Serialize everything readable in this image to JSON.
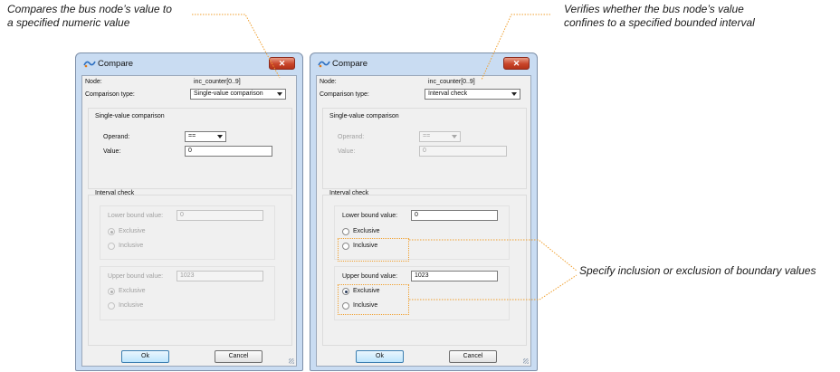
{
  "annotations": {
    "left_line1": "Compares the bus node’s value to",
    "left_line2": "a specified numeric value",
    "right_line1": "Verifies whether the bus node’s value",
    "right_line2": "confines to a specified bounded interval",
    "boundary": "Specify inclusion or exclusion of boundary values"
  },
  "colors": {
    "leader": "#f0a030",
    "titlebar": "#c9dcf2",
    "client_bg": "#f0f0f0",
    "close": "#c9452a"
  },
  "dialogs": [
    {
      "title": "Compare",
      "close_label": "✕",
      "node_label": "Node:",
      "node_value": "inc_counter[0..9]",
      "comparison_type_label": "Comparison type:",
      "comparison_type_value": "Single-value comparison",
      "single_group_title": "Single-value comparison",
      "operand_label": "Operand:",
      "operand_value": "==",
      "value_label": "Value:",
      "value_value": "0",
      "interval_group_title": "Interval check",
      "lower_label": "Lower bound value:",
      "lower_value": "0",
      "upper_label": "Upper bound value:",
      "upper_value": "1023",
      "exclusive_label": "Exclusive",
      "inclusive_label": "Inclusive",
      "ok_label": "Ok",
      "cancel_label": "Cancel"
    },
    {
      "title": "Compare",
      "close_label": "✕",
      "node_label": "Node:",
      "node_value": "inc_counter[0..9]",
      "comparison_type_label": "Comparison type:",
      "comparison_type_value": "Interval check",
      "single_group_title": "Single-value comparison",
      "operand_label": "Operand:",
      "operand_value": "==",
      "value_label": "Value:",
      "value_value": "0",
      "interval_group_title": "Interval check",
      "lower_label": "Lower bound value:",
      "lower_value": "0",
      "upper_label": "Upper bound value:",
      "upper_value": "1023",
      "exclusive_label": "Exclusive",
      "inclusive_label": "Inclusive",
      "ok_label": "Ok",
      "cancel_label": "Cancel"
    }
  ]
}
